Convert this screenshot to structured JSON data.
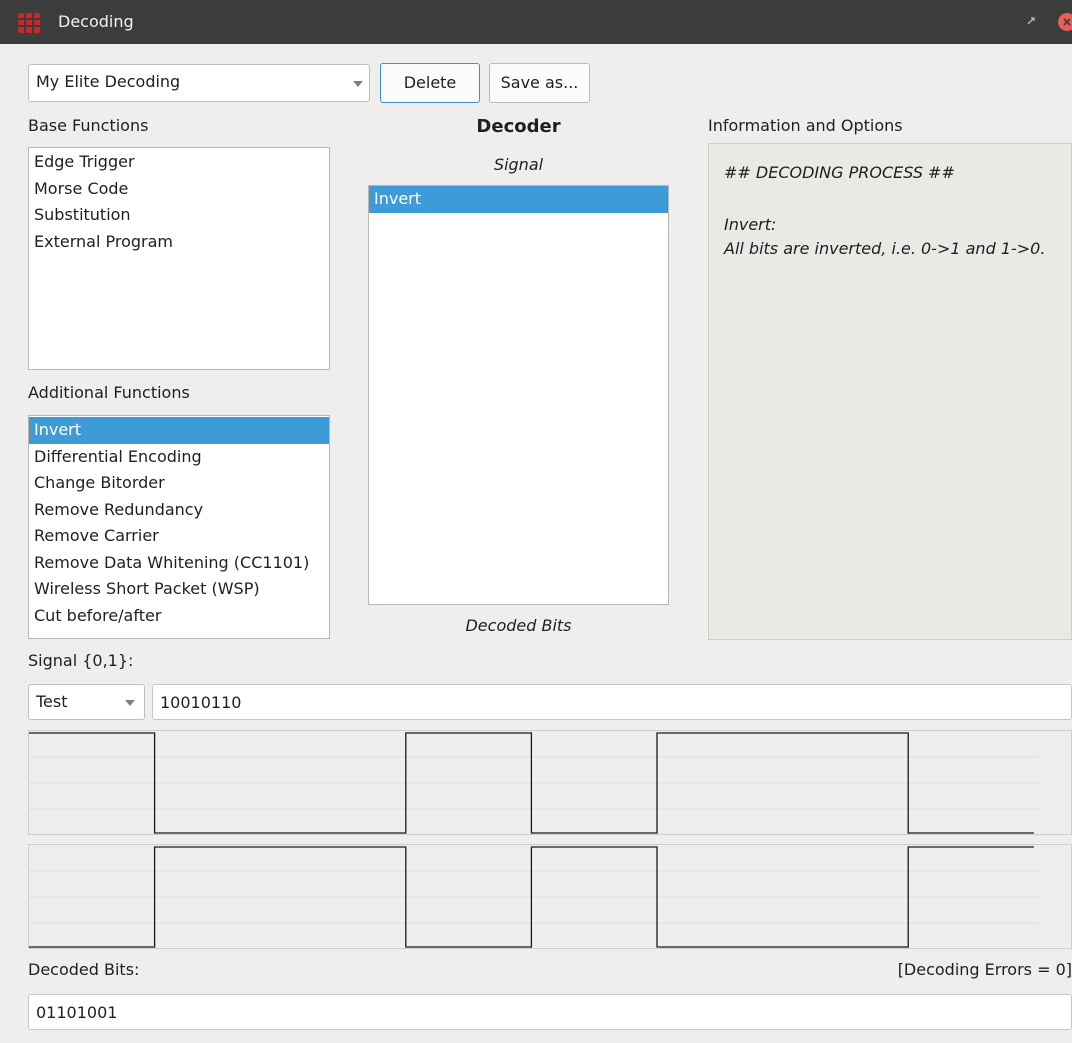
{
  "window": {
    "title": "Decoding"
  },
  "toolbar": {
    "decoding_select": "My Elite Decoding",
    "delete_label": "Delete",
    "save_as_label": "Save as..."
  },
  "base_functions": {
    "heading": "Base Functions",
    "items": [
      "Edge Trigger",
      "Morse Code",
      "Substitution",
      "External Program"
    ]
  },
  "additional_functions": {
    "heading": "Additional Functions",
    "items": [
      "Invert",
      "Differential Encoding",
      "Change Bitorder",
      "Remove Redundancy",
      "Remove Carrier",
      "Remove Data Whitening (CC1101)",
      "Wireless Short Packet (WSP)",
      "Cut before/after"
    ],
    "selected_index": 0
  },
  "decoder": {
    "heading": "Decoder",
    "signal_label": "Signal",
    "chain": [
      "Invert"
    ],
    "decoded_bits_label": "Decoded Bits"
  },
  "info": {
    "heading": "Information and Options",
    "lines": [
      "## DECODING PROCESS ##",
      "Invert:",
      "All bits are inverted, i.e. 0->1 and 1->0."
    ]
  },
  "signal": {
    "label": "Signal {0,1}:",
    "source_select": "Test",
    "value": "10010110"
  },
  "waveforms": {
    "input_bits": "10010110",
    "output_bits": "01101001"
  },
  "decoded": {
    "label": "Decoded Bits:",
    "errors_label": "[Decoding Errors = 0]",
    "value": "01101001"
  },
  "colors": {
    "selection": "#3d9bd8",
    "titlebar": "#3c3c3c",
    "close_button": "#e95f53"
  },
  "icons": [
    "app-icon",
    "restore-icon",
    "close-icon",
    "chevron-down-icon"
  ]
}
